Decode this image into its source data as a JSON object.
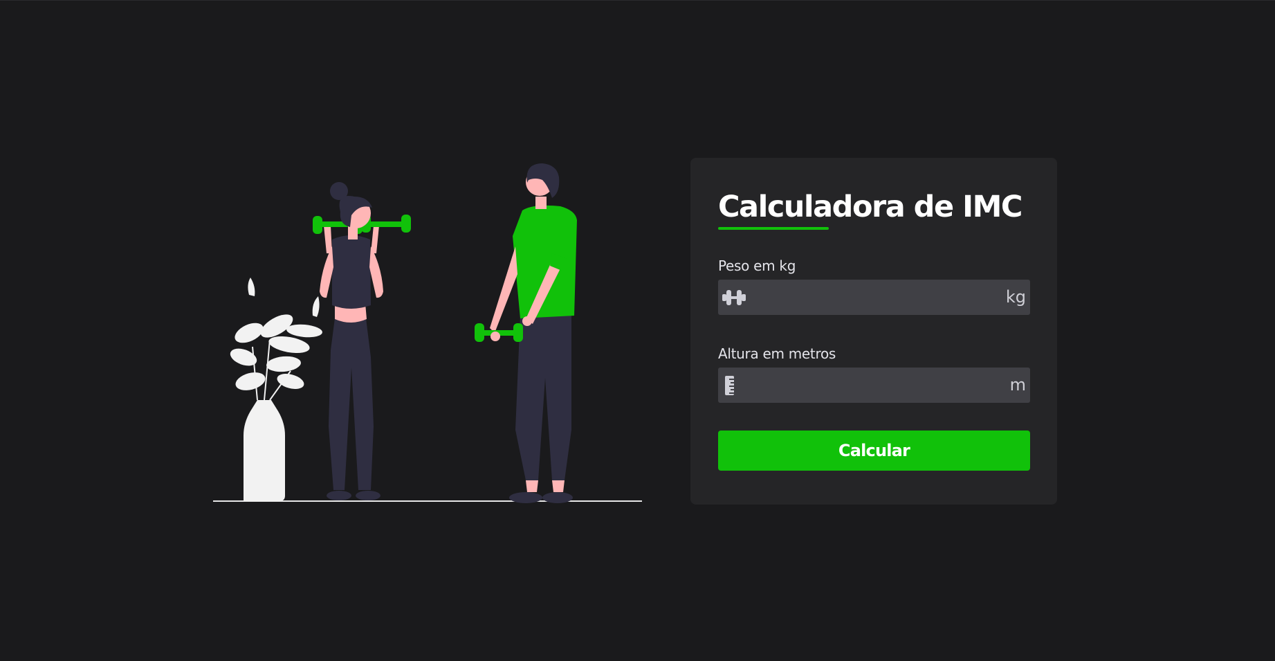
{
  "card": {
    "title": "Calculadora de IMC",
    "weight": {
      "label": "Peso em kg",
      "value": "",
      "placeholder": "",
      "unit": "kg"
    },
    "height": {
      "label": "Altura em metros",
      "value": "",
      "placeholder": "",
      "unit": "m"
    },
    "button_label": "Calcular"
  },
  "icons": {
    "weight": "dumbbell-icon",
    "height": "ruler-icon"
  },
  "colors": {
    "background": "#1a1a1c",
    "card": "#252527",
    "input": "#404045",
    "accent": "#11c10a",
    "text": "#ffffff"
  }
}
